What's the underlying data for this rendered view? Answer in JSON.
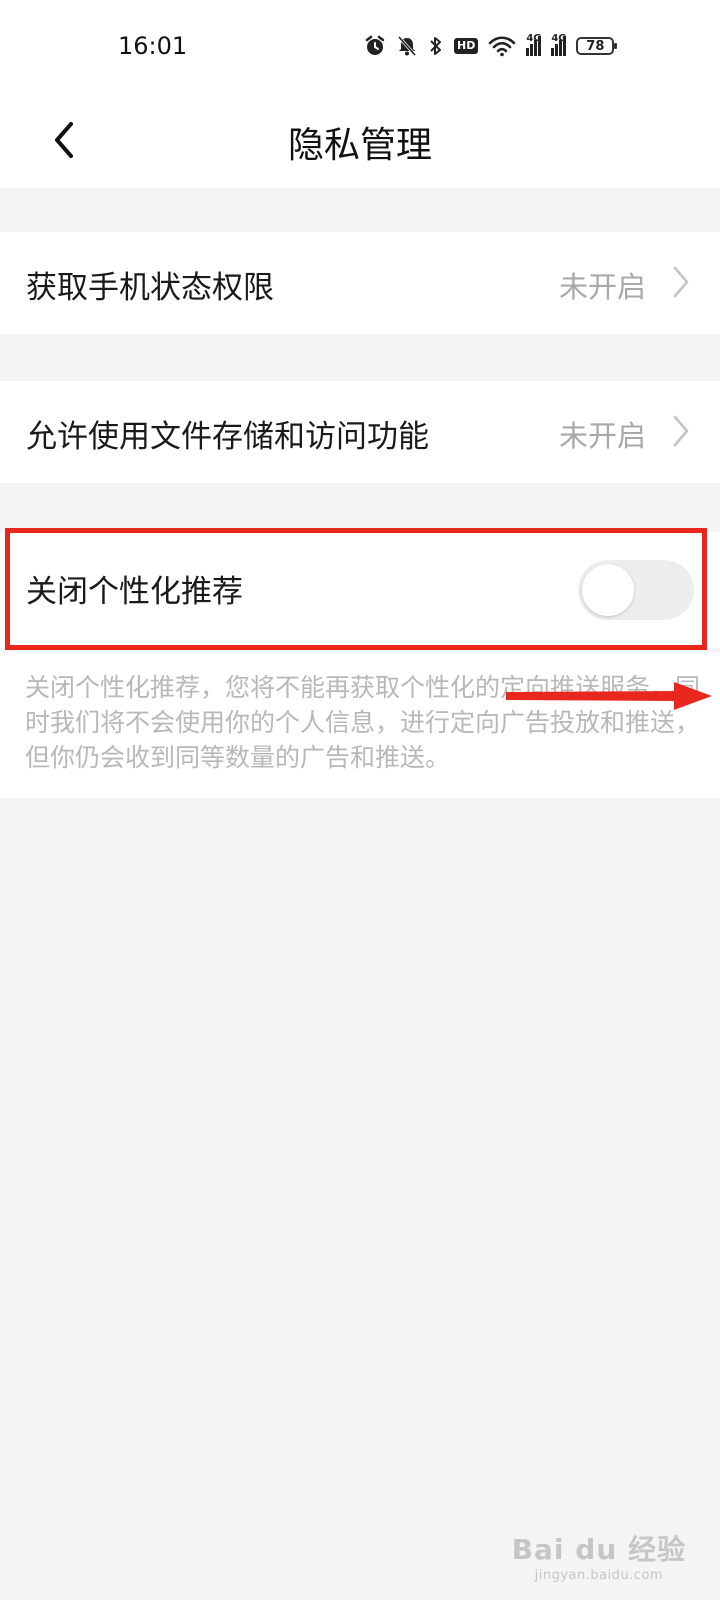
{
  "status_bar": {
    "time": "16:01",
    "hd_label": "HD",
    "network_1": "4G",
    "network_2": "4G",
    "battery": "78"
  },
  "header": {
    "title": "隐私管理"
  },
  "settings": [
    {
      "label": "获取手机状态权限",
      "value": "未开启"
    },
    {
      "label": "允许使用文件存储和访问功能",
      "value": "未开启"
    }
  ],
  "personalization": {
    "label": "关闭个性化推荐",
    "toggle_on": false,
    "description": "关闭个性化推荐，您将不能再获取个性化的定向推送服务，同时我们将不会使用你的个人信息，进行定向广告投放和推送，但你仍会收到同等数量的广告和推送。"
  },
  "annotation": {
    "highlight_color": "#e8271e"
  },
  "watermark": {
    "brand": "Bai du 经验",
    "domain": "jingyan.baidu.com"
  }
}
